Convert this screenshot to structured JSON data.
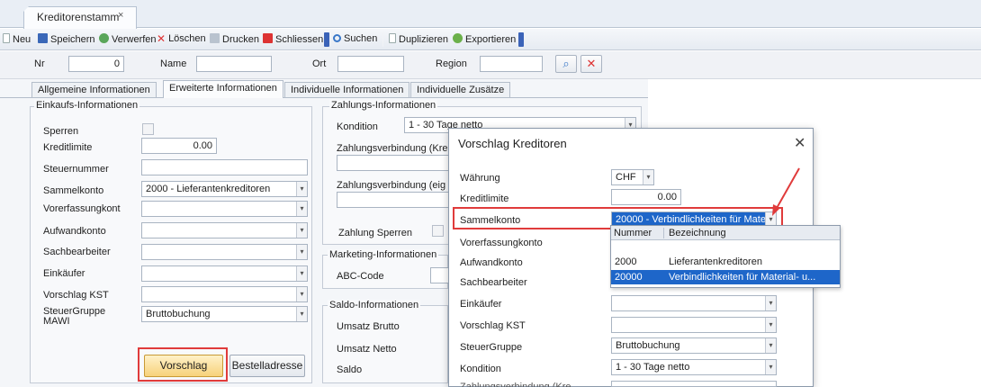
{
  "doc_tab": {
    "label": "Kreditorenstamm",
    "close": "×"
  },
  "toolbar": {
    "neu": "Neu",
    "speichern": "Speichern",
    "verwerfen": "Verwerfen",
    "loeschen": "Löschen",
    "drucken": "Drucken",
    "schliessen": "Schliessen",
    "suchen": "Suchen",
    "duplizieren": "Duplizieren",
    "exportieren": "Exportieren"
  },
  "filter": {
    "nr_label": "Nr",
    "nr_value": "0",
    "name_label": "Name",
    "name_value": "",
    "ort_label": "Ort",
    "ort_value": "",
    "region_label": "Region",
    "region_value": ""
  },
  "tabs": [
    "Allgemeine Informationen",
    "Erweiterte Informationen",
    "Individuelle Informationen",
    "Individuelle Zusätze"
  ],
  "einkauf": {
    "title": "Einkaufs-Informationen",
    "sperren": "Sperren",
    "kreditlimite": "Kreditlimite",
    "kreditlimite_value": "0.00",
    "steuernummer": "Steuernummer",
    "sammelkonto": "Sammelkonto",
    "sammelkonto_value": "2000 - Lieferantenkreditoren",
    "vorerfassungkont": "Vorerfassungkont",
    "aufwandkonto": "Aufwandkonto",
    "sachbearbeiter": "Sachbearbeiter",
    "einkaeufer": "Einkäufer",
    "vorschlag_kst": "Vorschlag KST",
    "steuergruppe_1": "SteuerGruppe",
    "steuergruppe_2": "MAWI",
    "steuergruppe_value": "Bruttobuchung"
  },
  "buttons": {
    "vorschlag": "Vorschlag",
    "bestelladresse": "Bestelladresse"
  },
  "zahlung": {
    "title": "Zahlungs-Informationen",
    "kondition": "Kondition",
    "kondition_value": "1 - 30 Tage netto",
    "verb_kre": "Zahlungsverbindung (Kre",
    "verb_eig": "Zahlungsverbindung (eig",
    "sperren": "Zahlung Sperren"
  },
  "marketing": {
    "title": "Marketing-Informationen",
    "abc": "ABC-Code"
  },
  "saldo": {
    "title": "Saldo-Informationen",
    "umsatz_brutto": "Umsatz Brutto",
    "umsatz_netto": "Umsatz Netto",
    "saldo": "Saldo"
  },
  "dialog": {
    "title": "Vorschlag Kreditoren",
    "close": "✕",
    "waehrung": "Währung",
    "waehrung_value": "CHF",
    "kreditlimite": "Kreditlimite",
    "kreditlimite_value": "0.00",
    "sammelkonto": "Sammelkonto",
    "sammelkonto_value": "20000 - Verbindlichkeiten für Materi",
    "vorerfassungkonto": "Vorerfassungkonto",
    "aufwandkonto": "Aufwandkonto",
    "sachbearbeiter": "Sachbearbeiter",
    "einkaeufer": "Einkäufer",
    "vorschlag_kst": "Vorschlag KST",
    "steuergruppe": "SteuerGruppe",
    "steuergruppe_value": "Bruttobuchung",
    "kondition": "Kondition",
    "kondition_value": "1 - 30 Tage netto",
    "cut_label": "Zahlungsverbindung (Kre"
  },
  "popup": {
    "col_nummer": "Nummer",
    "col_bezeichnung": "Bezeichnung",
    "rows": [
      {
        "nummer": "2000",
        "bezeichnung": "Lieferantenkreditoren"
      },
      {
        "nummer": "20000",
        "bezeichnung": "Verbindlichkeiten für Material- u..."
      }
    ]
  },
  "colors": {
    "accent_red": "#e03b3b",
    "selection_blue": "#1e66c9",
    "button_yellow": "#f7d27a"
  }
}
